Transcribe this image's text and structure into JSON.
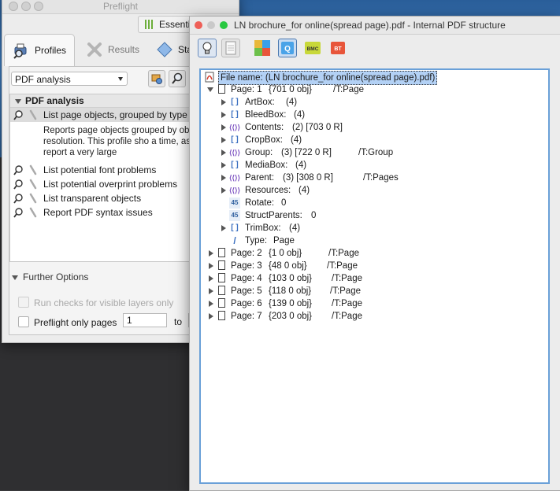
{
  "preflight": {
    "title": "Preflight",
    "essentials_label": "Essenti",
    "tabs": [
      {
        "label": "Profiles",
        "icon": "printer-magnifier-icon"
      },
      {
        "label": "Results",
        "icon": "wrench-cross-icon"
      },
      {
        "label": "Sta",
        "icon": "diamond-standards-icon"
      }
    ],
    "library_select": "PDF analysis",
    "group_title": "PDF analysis",
    "profiles": [
      "List page objects, grouped by type o",
      "List potential font problems",
      "List potential overprint problems",
      "List transparent objects",
      "Report PDF syntax issues"
    ],
    "description": "Reports page objects grouped by ob by image resolution. This profile sho a time, as it may report a very large",
    "further_options": "Further Options",
    "opt_visible_layers": "Run checks for visible layers only",
    "opt_only_pages": "Preflight only pages",
    "page_from": "1",
    "page_to_label": "to"
  },
  "structure": {
    "title": "LN  brochure_for online(spread page).pdf - Internal PDF structure",
    "toolbar": [
      "lightbulb-icon",
      "document-icon",
      "puzzle-icon",
      "q-puzzle-icon",
      "bmc-puzzle-icon",
      "bt-puzzle-icon"
    ],
    "root": "File name: (LN  brochure_for online(spread page).pdf)",
    "page1": {
      "label": "Page: 1",
      "obj": "{701 0 obj}",
      "type": "/T:Page"
    },
    "children": [
      {
        "name": "ArtBox:",
        "value": "(4)",
        "extra": "",
        "icon": "array-icon",
        "expand": true
      },
      {
        "name": "BleedBox:",
        "value": "(4)",
        "extra": "",
        "icon": "array-icon",
        "expand": true
      },
      {
        "name": "Contents:",
        "value": "(2) [703 0 R]",
        "extra": "",
        "icon": "dict-icon",
        "expand": true
      },
      {
        "name": "CropBox:",
        "value": "(4)",
        "extra": "",
        "icon": "array-icon",
        "expand": true
      },
      {
        "name": "Group:",
        "value": "(3) [722 0 R]",
        "extra": "/T:Group",
        "icon": "dict-icon",
        "expand": true
      },
      {
        "name": "MediaBox:",
        "value": "(4)",
        "extra": "",
        "icon": "array-icon",
        "expand": true
      },
      {
        "name": "Parent:",
        "value": "(3) [308 0 R]",
        "extra": "/T:Pages",
        "icon": "dict-icon",
        "expand": true
      },
      {
        "name": "Resources:",
        "value": "(4)",
        "extra": "",
        "icon": "dict-icon",
        "expand": true
      },
      {
        "name": "Rotate:",
        "value": "0",
        "extra": "",
        "icon": "number-icon",
        "expand": false
      },
      {
        "name": "StructParents:",
        "value": "0",
        "extra": "",
        "icon": "number-icon",
        "expand": false
      },
      {
        "name": "TrimBox:",
        "value": "(4)",
        "extra": "",
        "icon": "array-icon",
        "expand": true
      },
      {
        "name": "Type:",
        "value": "Page",
        "extra": "",
        "icon": "name-icon",
        "expand": false
      }
    ],
    "pages": [
      {
        "label": "Page: 2",
        "obj": "{1 0 obj}",
        "type": "/T:Page"
      },
      {
        "label": "Page: 3",
        "obj": "{48 0 obj}",
        "type": "/T:Page"
      },
      {
        "label": "Page: 4",
        "obj": "{103 0 obj}",
        "type": "/T:Page"
      },
      {
        "label": "Page: 5",
        "obj": "{118 0 obj}",
        "type": "/T:Page"
      },
      {
        "label": "Page: 6",
        "obj": "{139 0 obj}",
        "type": "/T:Page"
      },
      {
        "label": "Page: 7",
        "obj": "{203 0 obj}",
        "type": "/T:Page"
      }
    ]
  },
  "colors": {
    "selection": "#b3d1f5",
    "accent": "#6aa0d8",
    "close": "#ee5f57",
    "minimize": "#c9c9c9",
    "zoom": "#28c840"
  }
}
